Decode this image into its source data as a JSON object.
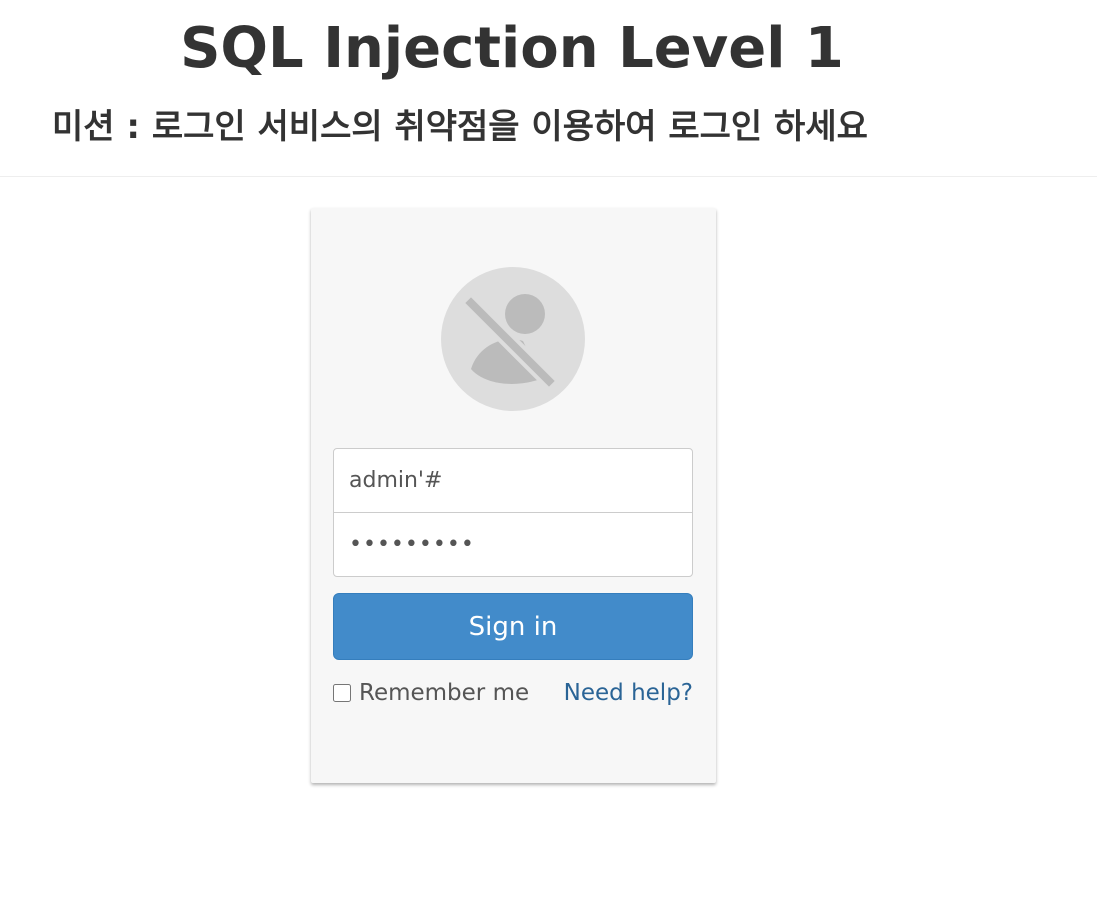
{
  "header": {
    "title": "SQL Injection Level 1",
    "mission": "미션 : 로그인 서비스의 취약점을 이용하여 로그인 하세요"
  },
  "login": {
    "avatar_icon": "user-disabled-icon",
    "username_value": "admin'#",
    "password_value": "password1",
    "signin_label": "Sign in",
    "remember_label": "Remember me",
    "help_label": "Need help?"
  },
  "colors": {
    "primary_button": "#428bca",
    "link": "#2a6496",
    "card_background": "#f7f7f7",
    "avatar_background": "#dddddd"
  }
}
